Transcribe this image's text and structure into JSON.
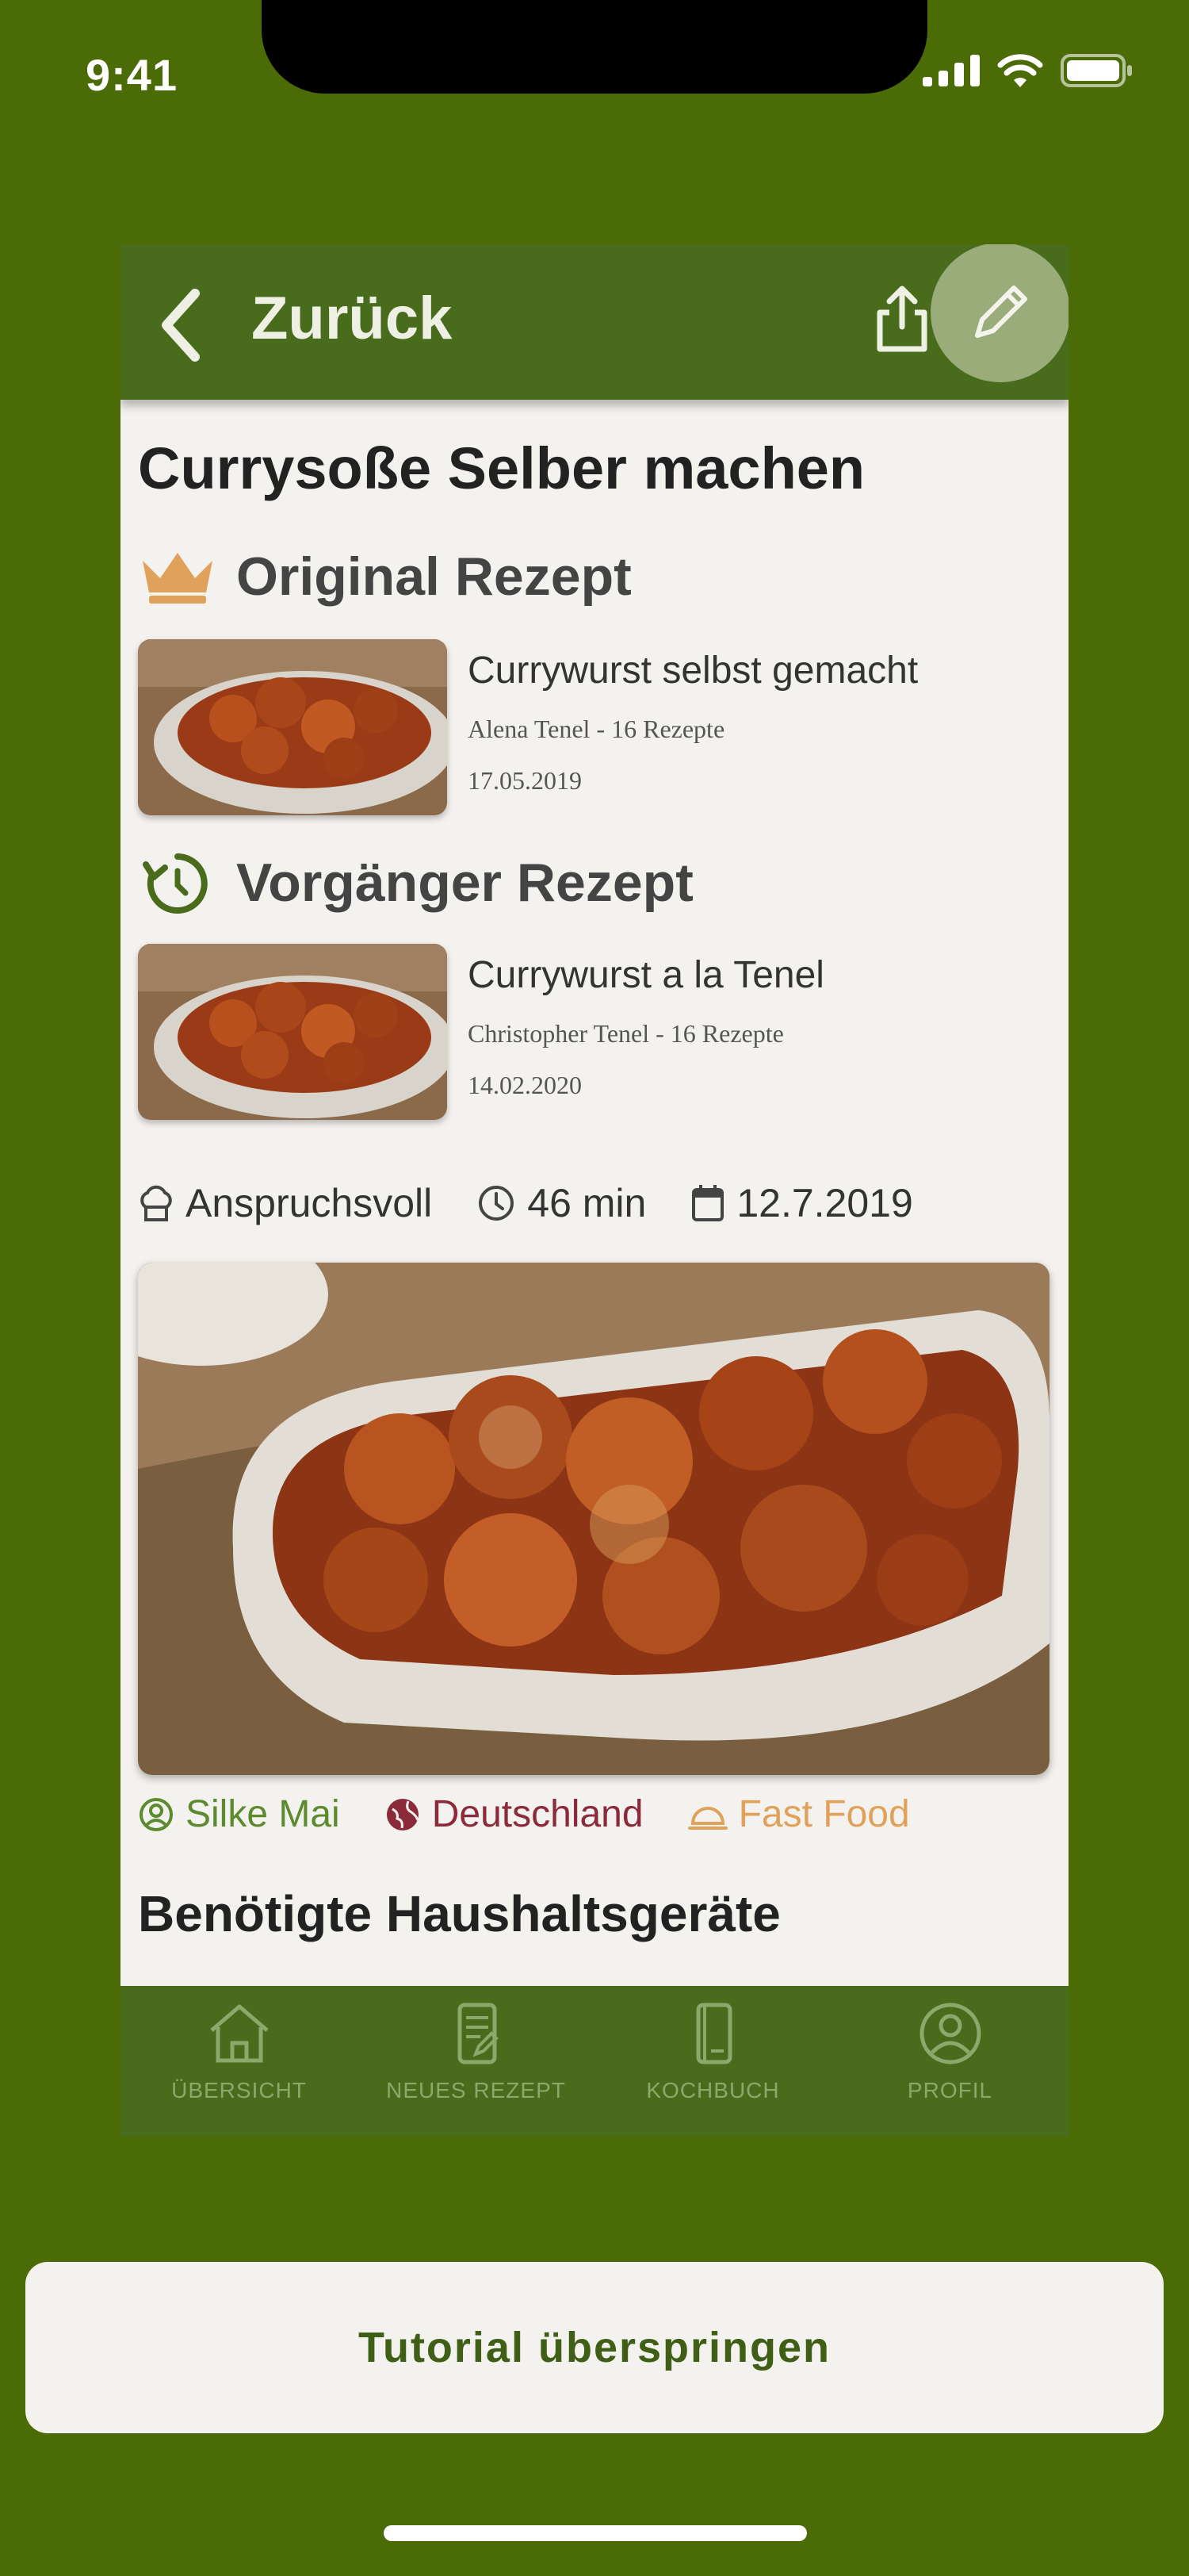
{
  "status_bar": {
    "time": "9:41"
  },
  "header": {
    "back_label": "Zurück"
  },
  "recipe": {
    "title": "Currysoße Selber machen",
    "original": {
      "section_title": "Original Rezept",
      "card_title": "Currywurst selbst gemacht",
      "author": "Alena Tenel - 16 Rezepte",
      "date": "17.05.2019"
    },
    "previous": {
      "section_title": "Vorgänger Rezept",
      "card_title": "Currywurst a la Tenel",
      "author": "Christopher Tenel - 16 Rezepte",
      "date": "14.02.2020"
    },
    "meta": {
      "difficulty": "Anspruchsvoll",
      "duration": "46 min",
      "date": "12.7.2019"
    },
    "tags": {
      "author": "Silke Mai",
      "country": "Deutschland",
      "category": "Fast Food"
    },
    "appliances_title": "Benötigte Haushaltsgeräte"
  },
  "bottom_nav": {
    "items": [
      {
        "label": "ÜBERSICHT",
        "icon": "home-icon"
      },
      {
        "label": "NEUES REZEPT",
        "icon": "note-edit-icon"
      },
      {
        "label": "KOCHBUCH",
        "icon": "book-icon"
      },
      {
        "label": "PROFIL",
        "icon": "profile-icon"
      }
    ]
  },
  "tutorial": {
    "skip_label": "Tutorial überspringen"
  },
  "colors": {
    "background": "#4a6b06",
    "header": "#486b1c",
    "tag_author": "#5c8a2e",
    "tag_country": "#8b2a3a",
    "tag_category": "#e0a25a",
    "crown": "#e0a25a"
  }
}
